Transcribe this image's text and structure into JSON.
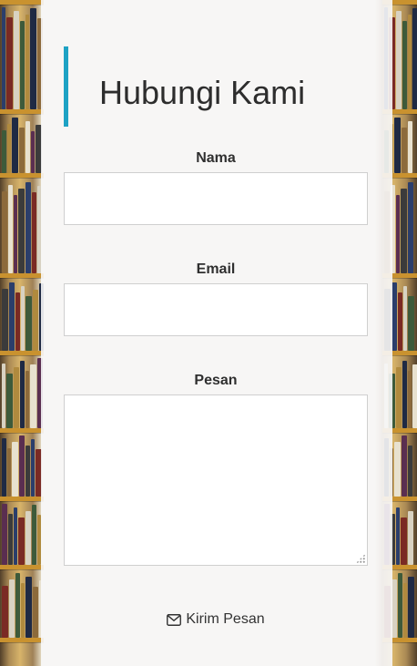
{
  "header": {
    "fragment": "Hubungi Kami"
  },
  "form": {
    "title": "Hubungi Kami",
    "fields": {
      "name": {
        "label": "Nama",
        "value": ""
      },
      "email": {
        "label": "Email",
        "value": ""
      },
      "message": {
        "label": "Pesan",
        "value": ""
      }
    },
    "submit": {
      "label": "Kirim Pesan",
      "icon": "envelope-icon"
    }
  },
  "colors": {
    "accent": "#1ea2c4",
    "panel": "#f8f8fa",
    "shelf": "#c9922f"
  }
}
